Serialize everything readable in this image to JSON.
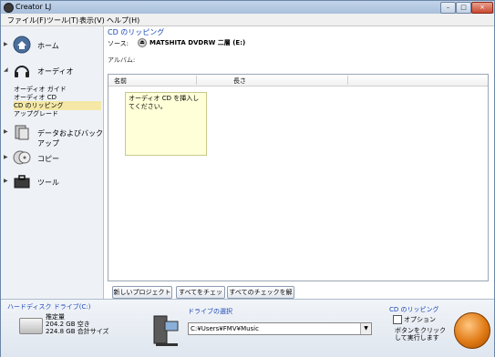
{
  "window": {
    "title": "Creator LJ",
    "minimize": "–",
    "maximize": "□",
    "close": "×"
  },
  "menu": [
    "ファイル(F)",
    "ツール(T)",
    "表示(V)",
    "ヘルプ(H)"
  ],
  "sidebar": {
    "home": "ホーム",
    "audio": "オーディオ",
    "audio_sub": [
      "オーディオ ガイド",
      "オーディオ CD",
      "CD のリッピング",
      "アップグレード"
    ],
    "data": "データおよびバックアップ",
    "copy": "コピー",
    "tools": "ツール"
  },
  "content": {
    "title": "CD のリッピング",
    "source_label": "ソース:",
    "source_value": "MATSHITA DVDRW 二層 (E:)",
    "album_label": "アルバム:",
    "columns": [
      "名前",
      "長さ"
    ],
    "note": "オーディオ CD を挿入してください。",
    "buttons": [
      "新しいプロジェクト(N)",
      "すべてをチェック",
      "すべてのチェックを解除"
    ]
  },
  "bottom": {
    "drive_title": "ハードディスク ドライブ(C:)",
    "estimate_label": "推定量",
    "free": "204.2 GB 空き",
    "total": "224.8 GB 合計サイズ",
    "drive_select_title": "ドライブの選択",
    "drive_path": "C:¥Users¥FMV¥Music",
    "rip_title": "CD のリッピング",
    "option_label": "オプション",
    "rip_hint": "ボタンをクリックして実行します"
  }
}
